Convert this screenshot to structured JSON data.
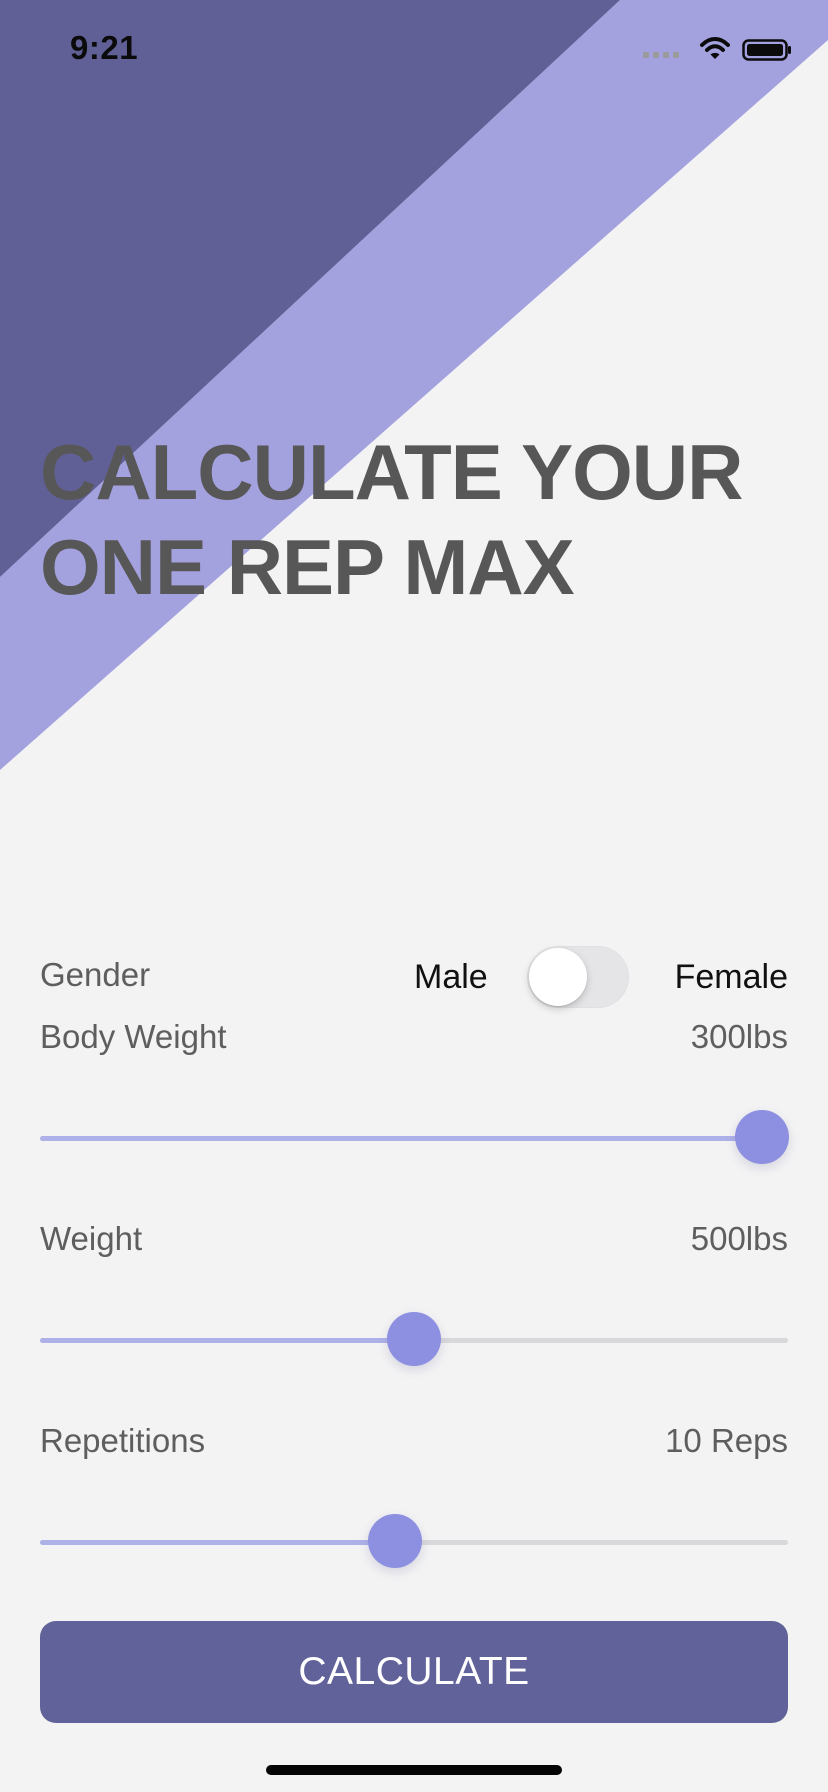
{
  "status_bar": {
    "time": "9:21",
    "icons": [
      "signal-icon",
      "wifi-icon",
      "battery-icon"
    ]
  },
  "hero": {
    "title_line_1": "CALCULATE YOUR",
    "title_line_2": "ONE REP MAX"
  },
  "form": {
    "gender": {
      "label": "Gender",
      "left_option": "Male",
      "right_option": "Female",
      "selected": "Male",
      "toggle_on": false
    },
    "body_weight": {
      "label": "Body Weight",
      "value": "300lbs",
      "slider_fraction": 0.965
    },
    "weight": {
      "label": "Weight",
      "value": "500lbs",
      "slider_fraction": 0.5
    },
    "repetitions": {
      "label": "Repetitions",
      "value": "10 Reps",
      "slider_fraction": 0.475
    }
  },
  "actions": {
    "calculate_label": "CALCULATE"
  },
  "colors": {
    "background": "#f3f3f4",
    "dark_band": "#606097",
    "light_band": "#a3a2df",
    "button": "#62629b",
    "slider_thumb": "#8d8fe0",
    "slider_fill": "#aeb0e8",
    "title_text": "#575757",
    "label_text": "#5e5e5e"
  }
}
